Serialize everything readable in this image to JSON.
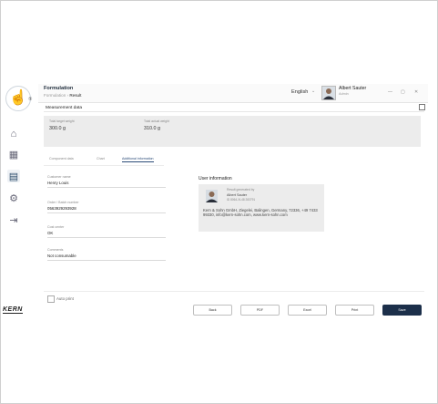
{
  "sidebar": {
    "logo_icon": "hand-pointer-icon",
    "logo_number": "⑤",
    "items": [
      {
        "icon": "home-icon",
        "glyph": "⌂"
      },
      {
        "icon": "grid-icon",
        "glyph": "▦"
      },
      {
        "icon": "database-icon",
        "glyph": "▤"
      },
      {
        "icon": "settings-icon",
        "glyph": "⚙"
      },
      {
        "icon": "logout-icon",
        "glyph": "⇥"
      }
    ],
    "brand": "KERN"
  },
  "header": {
    "title": "Formulation",
    "breadcrumb_parent": "Formulation",
    "breadcrumb_current": "Result",
    "language": "English",
    "user_name": "Albert Sauter",
    "user_role": "Admin"
  },
  "measurement": {
    "section_title": "Measurement data",
    "target_label": "Total target weight",
    "target_value": "300.0 g",
    "actual_label": "Total actual weight",
    "actual_value": "310.0 g"
  },
  "tabs": [
    {
      "label": "Component data",
      "active": false
    },
    {
      "label": "Chart",
      "active": false
    },
    {
      "label": "Additional information",
      "active": true
    }
  ],
  "fields": [
    {
      "label": "Customer name",
      "value": "Henry Louis"
    },
    {
      "label": "Order / Batch number",
      "value": "0563929293928"
    },
    {
      "label": "Cost center",
      "value": "OK"
    },
    {
      "label": "Comments",
      "value": "Not consumable"
    }
  ],
  "user_information": {
    "title": "User information",
    "line1": "Result generated by",
    "line2": "Albert Sauter",
    "line3": "ID 8064-XL48 283791",
    "address": "Kern & Sohn GmbH, Ziegelei, Balingen, Germany, 72336, +49 7433 99330, info@kern-sohn.com, www.kern-sohn.com"
  },
  "footer": {
    "auto_print": "Auto print",
    "buttons": [
      "Back",
      "PDF",
      "Excel",
      "Print",
      "Save"
    ]
  },
  "colors": {
    "primary": "#1c2f4a",
    "accent": "#2b4b78",
    "panel": "#ececec"
  }
}
